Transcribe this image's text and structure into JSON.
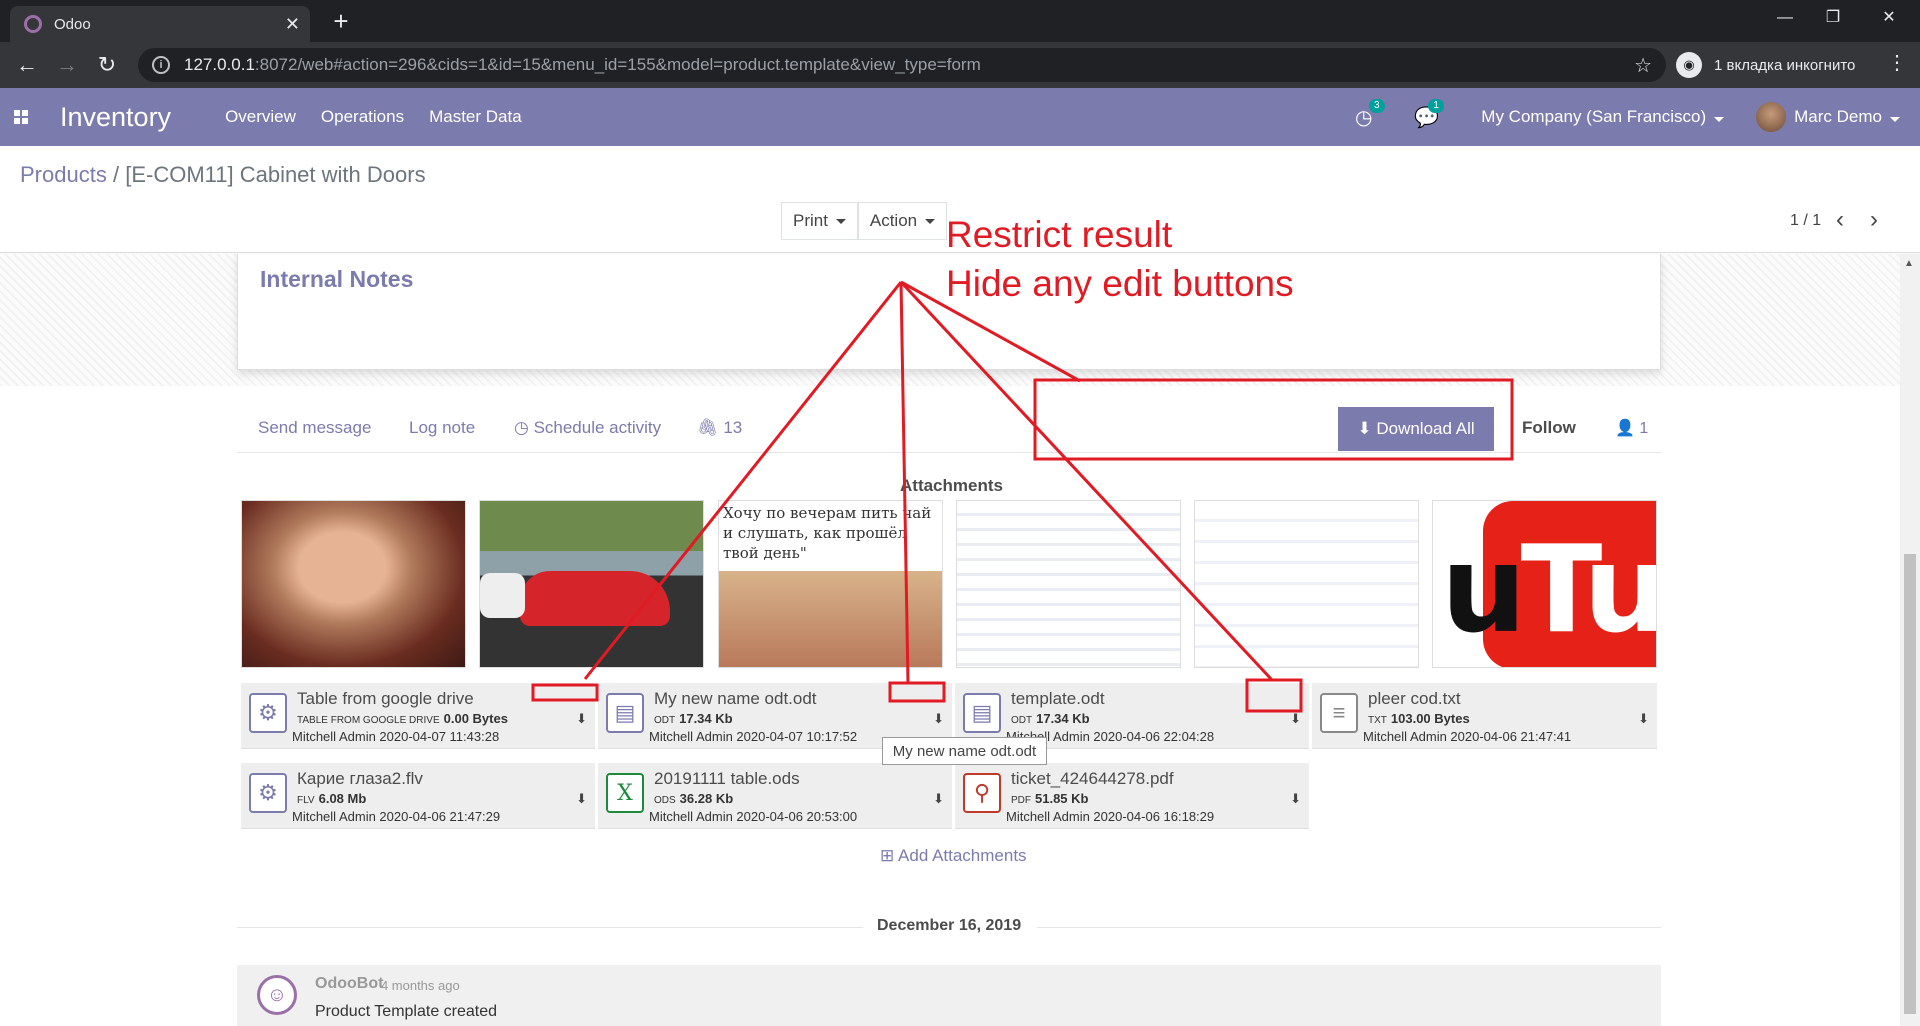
{
  "browser": {
    "tab_title": "Odoo",
    "url_host": "127.0.0.1",
    "url_rest": ":8072/web#action=296&cids=1&id=15&menu_id=155&model=product.template&view_type=form",
    "incognito_label": "1 вкладка инкогнито"
  },
  "navbar": {
    "app_name": "Inventory",
    "menu": [
      "Overview",
      "Operations",
      "Master Data"
    ],
    "activity_badge": "3",
    "messages_badge": "1",
    "company": "My Company (San Francisco)",
    "user": "Marc Demo"
  },
  "control": {
    "breadcrumb_root": "Products",
    "breadcrumb_sep": "/",
    "breadcrumb_current": "[E-COM11] Cabinet with Doors",
    "print_label": "Print",
    "action_label": "Action",
    "pager": "1 / 1"
  },
  "sheet": {
    "internal_notes": "Internal Notes"
  },
  "chatter": {
    "send_message": "Send message",
    "log_note": "Log note",
    "schedule_activity": "Schedule activity",
    "attachment_count": "13",
    "download_all": "Download All",
    "follow": "Follow",
    "followers": "1",
    "attachments_title": "Attachments",
    "thumb_text": "Хочу по вечерам пить чай и слушать, как прошёл твой день\"",
    "attachments": [
      {
        "name": "Table from google drive",
        "ext": "table from google drive",
        "size": "0.00 Bytes",
        "author": "Mitchell Admin 2020-04-07 11:43:28",
        "icon": "gear-icon"
      },
      {
        "name": "My new name odt.odt",
        "ext": "odt",
        "size": "17.34 Kb",
        "author": "Mitchell Admin 2020-04-07 10:17:52",
        "icon": "image-doc-icon"
      },
      {
        "name": "template.odt",
        "ext": "odt",
        "size": "17.34 Kb",
        "author": "Mitchell Admin 2020-04-06 22:04:28",
        "icon": "image-doc-icon"
      },
      {
        "name": "pleer cod.txt",
        "ext": "txt",
        "size": "103.00 Bytes",
        "author": "Mitchell Admin 2020-04-06 21:47:41",
        "icon": "text-file-icon"
      },
      {
        "name": "Карие глаза2.flv",
        "ext": "flv",
        "size": "6.08 Mb",
        "author": "Mitchell Admin 2020-04-06 21:47:29",
        "icon": "gear-icon"
      },
      {
        "name": "20191111 table.ods",
        "ext": "ods",
        "size": "36.28 Kb",
        "author": "Mitchell Admin 2020-04-06 20:53:00",
        "icon": "spreadsheet-icon"
      },
      {
        "name": "ticket_424644278.pdf",
        "ext": "pdf",
        "size": "51.85 Kb",
        "author": "Mitchell Admin 2020-04-06 16:18:29",
        "icon": "pdf-icon"
      }
    ],
    "tooltip": "My new name odt.odt",
    "add_attachments": "Add Attachments",
    "date_separator": "December 16, 2019",
    "message": {
      "author": "OdooBot",
      "time": "- 4 months ago",
      "body": "Product Template created"
    }
  },
  "annotation": {
    "line1": "Restrict result",
    "line2": "Hide any edit buttons",
    "color": "#e01b24"
  },
  "colors": {
    "brand": "#7c7bad",
    "chrome_dark": "#202124"
  }
}
